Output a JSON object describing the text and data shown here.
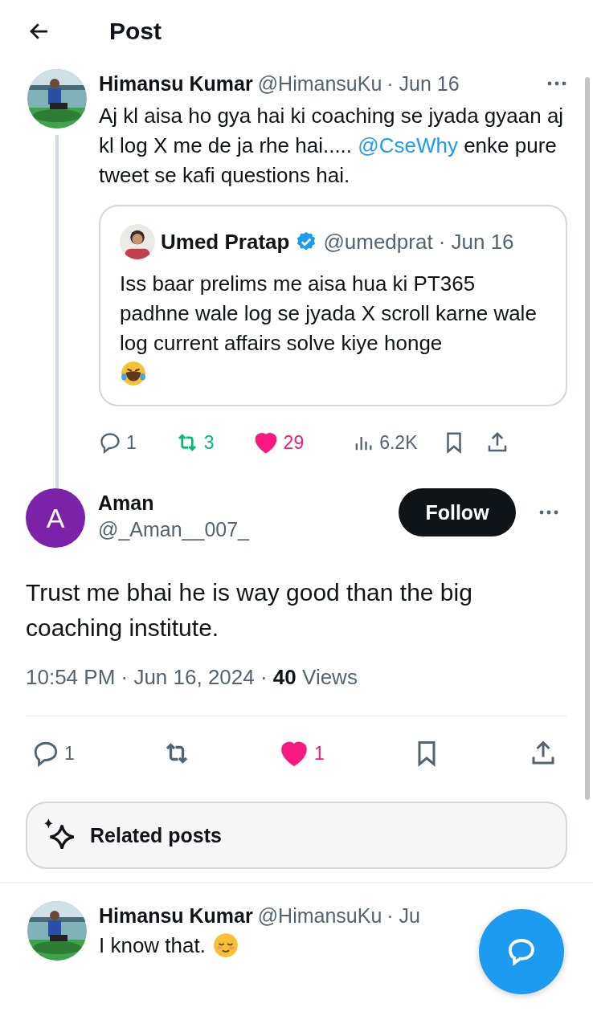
{
  "header": {
    "title": "Post"
  },
  "parent_post": {
    "name": "Himansu Kumar",
    "handle": "@HimansuKu",
    "time": "· Jun 16",
    "text": [
      {
        "kind": "text",
        "text": "Aj kl aisa ho gya hai ki coaching se jyada gyaan aj kl log X me de ja rhe hai..... "
      },
      {
        "kind": "mention",
        "text": "@CseWhy"
      },
      {
        "kind": "text",
        "text": "  enke pure tweet se  kafi questions hai."
      }
    ],
    "quote": {
      "name": "Umed Pratap",
      "verified": true,
      "handle": "@umedprat",
      "time": "· Jun 16",
      "text": "Iss baar prelims me aisa hua ki PT365 padhne wale log se jyada X scroll karne wale log current affairs solve kiye honge"
    },
    "stats": {
      "replies": "1",
      "reposts": "3",
      "reposted": true,
      "likes": "29",
      "liked": true,
      "views": "6.2K"
    }
  },
  "post": {
    "avatar_letter": "A",
    "name": "Aman",
    "handle": "@_Aman__007_",
    "follow": "Follow",
    "text": "Trust me bhai he is way good than the big coaching institute.",
    "time": "10:54 PM · Jun 16, 2024 · ",
    "views_count": "40",
    "views_label": " Views",
    "stats": {
      "replies": "1",
      "reposted": false,
      "likes": "1",
      "liked": true
    }
  },
  "related": {
    "label": "Related posts"
  },
  "reply": {
    "name": "Himansu Kumar",
    "handle": "@HimansuKu",
    "time": "· Ju",
    "text": "I know that."
  }
}
